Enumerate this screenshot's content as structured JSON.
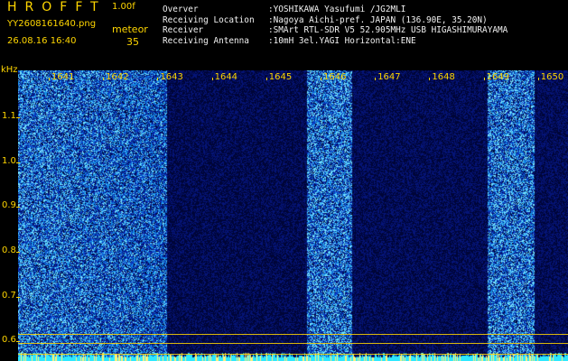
{
  "header": {
    "app_title": "HROFFT",
    "app_version": "1.00f",
    "file_name": "YY2608161640.png",
    "date_time": "26.08.16 16:40",
    "mode_label": "meteor",
    "count": "35"
  },
  "info": [
    {
      "key": "Overver",
      "value": ":YOSHIKAWA Yasufumi /JG2MLI"
    },
    {
      "key": "Receiving Location",
      "value": ":Nagoya Aichi-pref. JAPAN (136.90E, 35.20N)"
    },
    {
      "key": "Receiver",
      "value": ":SMArt RTL-SDR V5 52.905MHz USB HIGASHIMURAYAMA"
    },
    {
      "key": "Receiving Antenna",
      "value": ":10mH 3el.YAGI Horizontal:ENE"
    }
  ],
  "axis": {
    "y_unit": "kHz",
    "y_ticks": [
      "1.1",
      "1.0",
      "0.9",
      "0.8",
      "0.7",
      "0.6"
    ],
    "x_ticks": [
      "1641",
      "1642",
      "1643",
      "1644",
      "1645",
      "1646",
      "1647",
      "1648",
      "1649",
      "1650"
    ]
  },
  "colors": {
    "label": "#ffd600",
    "text": "#f2f2f2",
    "background": "#000000"
  }
}
